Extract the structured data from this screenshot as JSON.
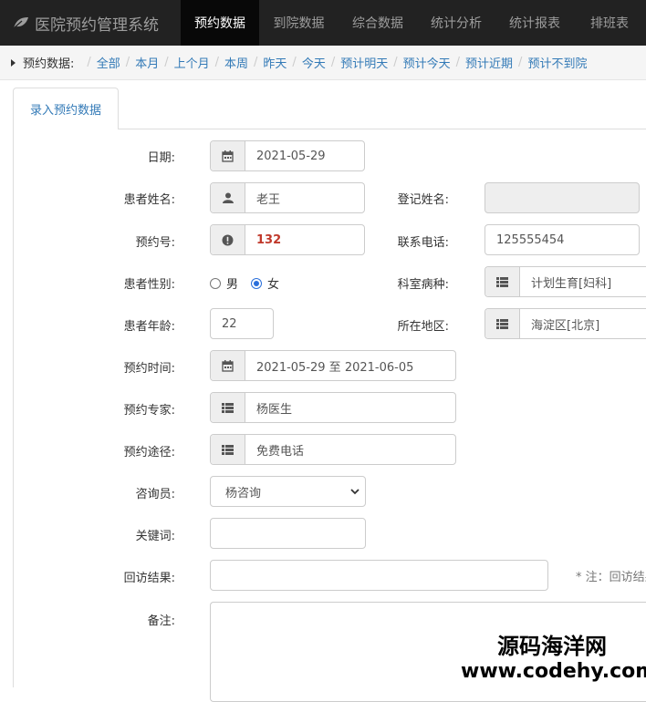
{
  "app": {
    "title": "医院预约管理系统"
  },
  "nav": {
    "tabs": [
      "预约数据",
      "到院数据",
      "综合数据",
      "统计分析",
      "统计报表",
      "排班表"
    ]
  },
  "breadcrumb": {
    "label": "预约数据:",
    "links": [
      "全部",
      "本月",
      "上个月",
      "本周",
      "昨天",
      "今天",
      "预计明天",
      "预计今天",
      "预计近期",
      "预计不到院"
    ]
  },
  "tab": {
    "label": "录入预约数据"
  },
  "form": {
    "date": {
      "label": "日期:",
      "value": "2021-05-29"
    },
    "patient_name": {
      "label": "患者姓名:",
      "value": "老王"
    },
    "register_name": {
      "label": "登记姓名:",
      "value": ""
    },
    "appt_no": {
      "label": "预约号:",
      "value": "132"
    },
    "phone": {
      "label": "联系电话:",
      "value": "125555454"
    },
    "gender": {
      "label": "患者性别:",
      "options": [
        "男",
        "女"
      ],
      "selected": "女"
    },
    "department": {
      "label": "科室病种:",
      "value": "计划生育[妇科]"
    },
    "age": {
      "label": "患者年龄:",
      "value": "22"
    },
    "region": {
      "label": "所在地区:",
      "value": "海淀区[北京]"
    },
    "appt_time": {
      "label": "预约时间:",
      "value": "2021-05-29 至 2021-06-05"
    },
    "expert": {
      "label": "预约专家:",
      "value": "杨医生"
    },
    "channel": {
      "label": "预约途径:",
      "value": "免费电话"
    },
    "consultant": {
      "label": "咨询员:",
      "value": "杨咨询"
    },
    "keyword": {
      "label": "关键词:",
      "value": ""
    },
    "followup": {
      "label": "回访结果:",
      "value": "",
      "note": "* 注：回访结果"
    },
    "remark": {
      "label": "备注:",
      "value": ""
    }
  },
  "watermark": {
    "line1": "源码海洋网",
    "line2": "www.codehy.com"
  }
}
